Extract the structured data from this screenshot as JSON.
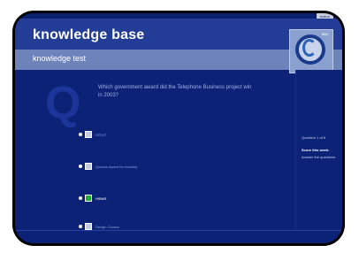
{
  "header": {
    "title": "knowledge base",
    "subtitle": "knowledge test",
    "top_button": "button"
  },
  "logo": {
    "icon": "company-logo",
    "text": "BBC"
  },
  "question": {
    "mark": "Q",
    "text": "Which government award did the Telephone Business project win in 2003?"
  },
  "answers": [
    {
      "label": "GOVIT",
      "selected": false
    },
    {
      "label": "Queens Award for Industry",
      "selected": false
    },
    {
      "label": "HIBNR",
      "selected": true
    },
    {
      "label": "Design Council",
      "selected": false
    }
  ],
  "sidebar": {
    "question_count": "Question 1 of 6",
    "result_label": "Score this week:",
    "result_value": "Answer the questions"
  },
  "colors": {
    "background": "#0b2276",
    "header": "#6f83bb",
    "checked": "#22aa33"
  }
}
